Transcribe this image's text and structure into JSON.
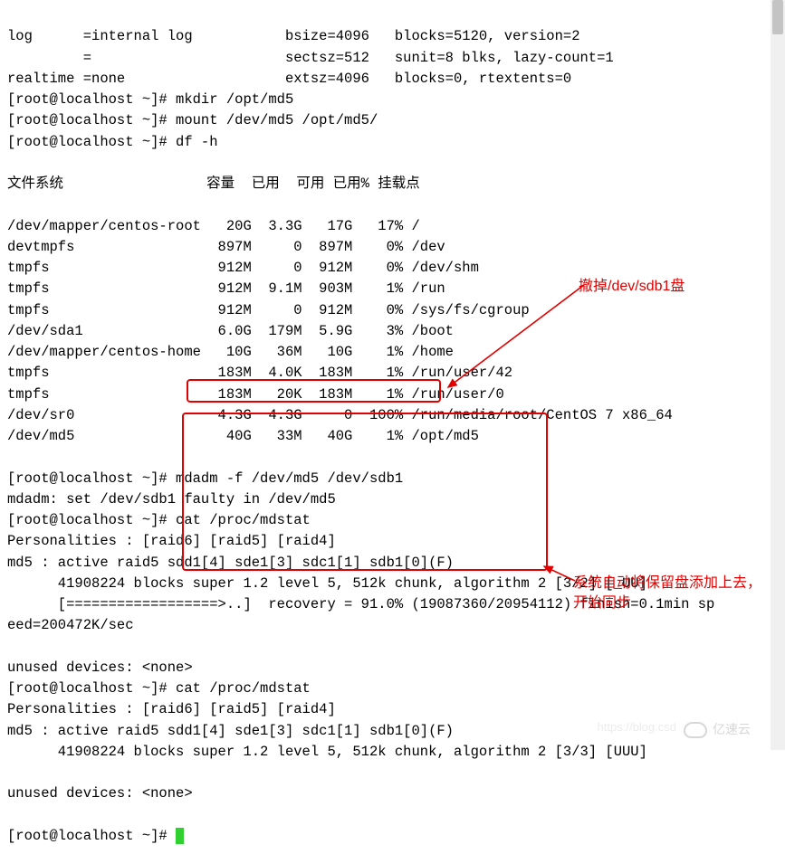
{
  "header_lines": [
    "log      =internal log           bsize=4096   blocks=5120, version=2",
    "         =                       sectsz=512   sunit=8 blks, lazy-count=1",
    "realtime =none                   extsz=4096   blocks=0, rtextents=0",
    "[root@localhost ~]# mkdir /opt/md5",
    "[root@localhost ~]# mount /dev/md5 /opt/md5/",
    "[root@localhost ~]# df -h"
  ],
  "df_header": "文件系统                 容量  已用  可用 已用% 挂载点",
  "df_rows": [
    {
      "fs": "/dev/mapper/centos-root",
      "size": "20G",
      "used": "3.3G",
      "avail": "17G",
      "pct": "17%",
      "mount": "/"
    },
    {
      "fs": "devtmpfs",
      "size": "897M",
      "used": "0",
      "avail": "897M",
      "pct": "0%",
      "mount": "/dev"
    },
    {
      "fs": "tmpfs",
      "size": "912M",
      "used": "0",
      "avail": "912M",
      "pct": "0%",
      "mount": "/dev/shm"
    },
    {
      "fs": "tmpfs",
      "size": "912M",
      "used": "9.1M",
      "avail": "903M",
      "pct": "1%",
      "mount": "/run"
    },
    {
      "fs": "tmpfs",
      "size": "912M",
      "used": "0",
      "avail": "912M",
      "pct": "0%",
      "mount": "/sys/fs/cgroup"
    },
    {
      "fs": "/dev/sda1",
      "size": "6.0G",
      "used": "179M",
      "avail": "5.9G",
      "pct": "3%",
      "mount": "/boot"
    },
    {
      "fs": "/dev/mapper/centos-home",
      "size": "10G",
      "used": "36M",
      "avail": "10G",
      "pct": "1%",
      "mount": "/home"
    },
    {
      "fs": "tmpfs",
      "size": "183M",
      "used": "4.0K",
      "avail": "183M",
      "pct": "1%",
      "mount": "/run/user/42"
    },
    {
      "fs": "tmpfs",
      "size": "183M",
      "used": "20K",
      "avail": "183M",
      "pct": "1%",
      "mount": "/run/user/0"
    },
    {
      "fs": "/dev/sr0",
      "size": "4.3G",
      "used": "4.3G",
      "avail": "0",
      "pct": "100%",
      "mount": "/run/media/root/CentOS 7 x86_64"
    },
    {
      "fs": "/dev/md5",
      "size": "40G",
      "used": "33M",
      "avail": "40G",
      "pct": "1%",
      "mount": "/opt/md5"
    }
  ],
  "after_lines": [
    "[root@localhost ~]# mdadm -f /dev/md5 /dev/sdb1",
    "mdadm: set /dev/sdb1 faulty in /dev/md5",
    "[root@localhost ~]# cat /proc/mdstat",
    "Personalities : [raid6] [raid5] [raid4] ",
    "md5 : active raid5 sdd1[4] sde1[3] sdc1[1] sdb1[0](F)",
    "      41908224 blocks super 1.2 level 5, 512k chunk, algorithm 2 [3/2] [_UU]",
    "      [==================>..]  recovery = 91.0% (19087360/20954112) finish=0.1min sp",
    "eed=200472K/sec",
    "      ",
    "unused devices: <none>",
    "[root@localhost ~]# cat /proc/mdstat",
    "Personalities : [raid6] [raid5] [raid4] ",
    "md5 : active raid5 sdd1[4] sde1[3] sdc1[1] sdb1[0](F)",
    "      41908224 blocks super 1.2 level 5, 512k chunk, algorithm 2 [3/3] [UUU]",
    "      ",
    "unused devices: <none>"
  ],
  "final_prompt": "[root@localhost ~]# ",
  "annotations": {
    "a1": "撤掉/dev/sdb1盘",
    "a2": "系统自动将保留盘添加上去，开始同步"
  },
  "watermark": {
    "logo_text": "亿速云",
    "url": "https://blog.csd"
  }
}
